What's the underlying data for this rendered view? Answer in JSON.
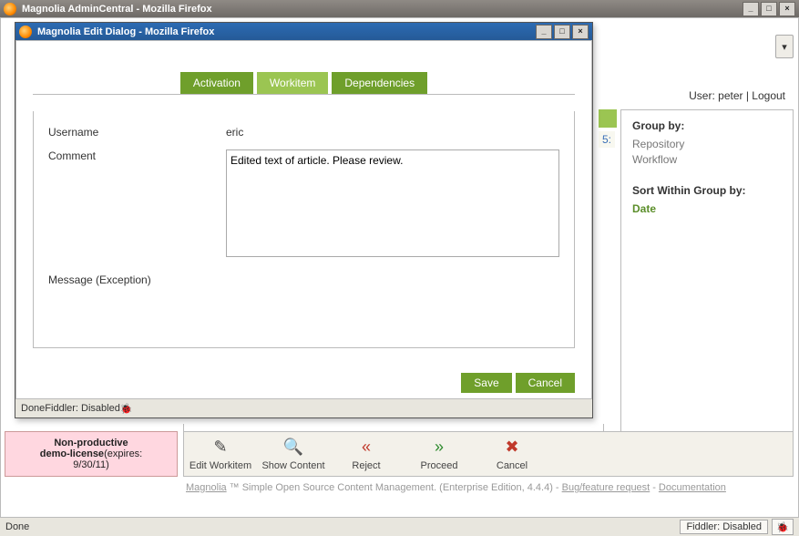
{
  "main_window": {
    "title": "Magnolia AdminCentral - Mozilla Firefox",
    "status_done": "Done",
    "fiddler": "Fiddler: Disabled"
  },
  "dialog": {
    "title": "Magnolia Edit Dialog - Mozilla Firefox",
    "tabs": {
      "activation": "Activation",
      "workitem": "Workitem",
      "dependencies": "Dependencies"
    },
    "fields": {
      "username_label": "Username",
      "username_value": "eric",
      "comment_label": "Comment",
      "comment_value": "Edited text of article. Please review.",
      "message_label": "Message (Exception)"
    },
    "buttons": {
      "save": "Save",
      "cancel": "Cancel"
    },
    "status_done": "Done",
    "fiddler": "Fiddler: Disabled"
  },
  "user_line": {
    "prefix": "User: ",
    "user": "peter",
    "sep": " |  ",
    "logout": "Logout"
  },
  "sidebar": {
    "group_by_title": "Group by:",
    "group_items": {
      "repository": "Repository",
      "workflow": "Workflow"
    },
    "sort_title": "Sort Within Group by:",
    "sort_value": "Date"
  },
  "time_fragment": "5:",
  "license": {
    "line1": "Non-productive",
    "line2": "demo-license",
    "expires_label": "(expires: ",
    "expires_date": "9/30/11)",
    "full_html": "Non-productive demo-license(expires: 9/30/11)"
  },
  "actions": {
    "edit": "Edit Workitem",
    "show": "Show Content",
    "reject": "Reject",
    "proceed": "Proceed",
    "cancel": "Cancel"
  },
  "footer": {
    "magnolia": "Magnolia",
    "text": " ™ Simple Open Source Content Management. (Enterprise Edition, 4.4.4) - ",
    "bug": "Bug/feature request",
    "sep": " - ",
    "doc": "Documentation"
  }
}
